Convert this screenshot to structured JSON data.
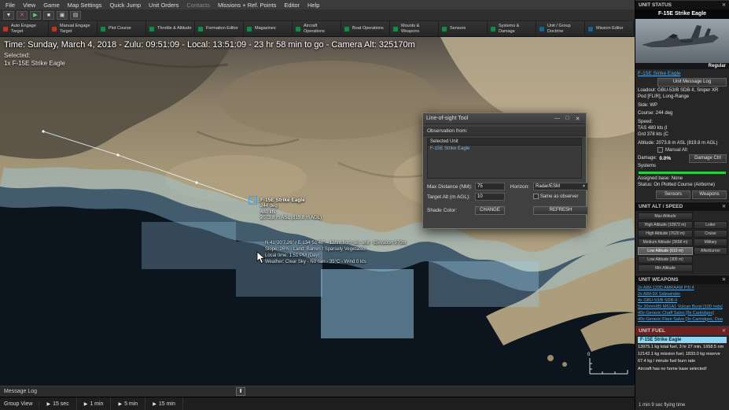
{
  "icons": {
    "close": "✕",
    "dropdown": "▼",
    "play": "▶",
    "stop": "■",
    "camera": "▣",
    "panel": "▤",
    "up_arrow": "⬆",
    "minimize": "—",
    "maximize": "□"
  },
  "colors": {
    "engage_red": "#b03a2e",
    "ops_green": "#1e8449",
    "doctrine_blue": "#21618c",
    "link_blue": "#5aa7e0",
    "systems_ok": "#2ecc40",
    "fuel_warning_header": "#6b2121",
    "selected_fuel_row": "#8fd6f2",
    "los_shade": "#9ed2ee"
  },
  "menu": {
    "items": [
      "File",
      "View",
      "Game",
      "Map Settings",
      "Quick Jump",
      "Unit Orders",
      "Contacts",
      "Missions + Ref. Points",
      "Editor",
      "Help"
    ]
  },
  "ribbon": {
    "buttons": [
      {
        "label": "Auto Engage Target",
        "color": "#b03a2e"
      },
      {
        "label": "Manual Engage Target",
        "color": "#b03a2e"
      },
      {
        "label": "Plot Course",
        "color": "#1e8449"
      },
      {
        "label": "Throttle & Altitude",
        "color": "#1e8449"
      },
      {
        "label": "Formation Editor",
        "color": "#1e8449"
      },
      {
        "label": "Magazines",
        "color": "#1e8449"
      },
      {
        "label": "Aircraft Operations",
        "color": "#1e8449"
      },
      {
        "label": "Boat Operations",
        "color": "#1e8449"
      },
      {
        "label": "Mounts & Weapons",
        "color": "#1e8449"
      },
      {
        "label": "Sensors",
        "color": "#1e8449"
      },
      {
        "label": "Systems & Damage",
        "color": "#1e8449"
      },
      {
        "label": "Unit / Group Doctrine",
        "color": "#21618c"
      },
      {
        "label": "Mission Editor",
        "color": "#21618c"
      }
    ]
  },
  "statusline": "Time: Sunday, March 4, 2018 - Zulu: 09:51:09 - Local: 13:51:09 - 23 hr 58 min to go -  Camera Alt: 325170m",
  "selected": {
    "label": "Selected:",
    "value": "1x F-15E Strike Eagle"
  },
  "map": {
    "unit_label": {
      "line1": "F-15E Strike Eagle",
      "line2": "244 deg",
      "line3": "480 kts",
      "line4": "2073.8 m ASL (819.8 m AGL)"
    },
    "cursor_info": {
      "line1": "N 41°20'7.26\" / E 134°51'40\" - 12nm from sel. unit - Elevation 970m",
      "line2": "Slope: 26% - Land: Barren / Sparsely Vegetated",
      "line3": "Local time: 1:51 PM (Day)",
      "line4": "Weather: Clear Sky - No rain - 35°C - Wind 0 kts"
    },
    "scale_zero": "0"
  },
  "dialog": {
    "title": "Line-of-sight Tool",
    "observation_label": "Observation from:",
    "list_header": "Selected Unit",
    "list_item": "F-15E Strike Eagle",
    "max_distance_label": "Max Distance (NM):",
    "max_distance_value": "75",
    "horizon_label": "Horizon:",
    "horizon_value": "Radar/ESM",
    "target_alt_label": "Target Alt (m AGL):",
    "target_alt_value": "10",
    "same_as_observer": "Same as observer",
    "shade_color_label": "Shade Color:",
    "change_button": "CHANGE",
    "refresh_button": "REFRESH"
  },
  "sidebar": {
    "unit_status": {
      "header": "UNIT STATUS",
      "title": "F-15E Strike Eagle",
      "proficiency": "Regular",
      "unit_link": "F-15E Strike Eagle",
      "message_log_button": "Unit Message Log",
      "loadout": "Loadout: GBU-53/B SDB-II, Sniper XR Pod [FLIR], Long-Range",
      "side": "Side: WP",
      "course": "Course: 244 deg",
      "speed_label": "Speed:",
      "speed_tas": "TAS 480 kts (I",
      "speed_grd": "Grd 378 kts (C",
      "altitude": "Altitude: 2073.8 m ASL (819.8 m AGL)",
      "manual_alt": "Manual Alt",
      "damage_label": "Damage:",
      "damage_value": "0.0%",
      "damage_button": "Damage Ctrl",
      "systems_label": "Systems",
      "assigned_base": "Assigned base: None",
      "status": "Status: On Plotted Course (Airborne)",
      "sensors_button": "Sensors",
      "weapons_button": "Weapons"
    },
    "alt_speed": {
      "header": "UNIT ALT / SPEED",
      "rows": [
        {
          "left": "Max Altitude",
          "right": ""
        },
        {
          "left": "High Altitude (10972 m)",
          "right": "Loiter"
        },
        {
          "left": "High Altitude (7620 m)",
          "right": "Cruise"
        },
        {
          "left": "Medium Altitude (3658 m)",
          "right": "Military"
        },
        {
          "left": "Low Altitude (610 m)",
          "right": "Afterburner"
        },
        {
          "left": "Low Altitude (305 m)",
          "right": ""
        },
        {
          "left": "Min Altitude",
          "right": ""
        }
      ]
    },
    "weapons": {
      "header": "UNIT WEAPONS",
      "items": [
        "2x AIM-120D AMRAAM P3I.4",
        "2x AIM-9X Sidewinder",
        "4x GBU-53/B SDB-II",
        "5x 20mm/85 M61A1 Vulcan Burst [100 rnds]",
        "40x Generic Chaff Salvo [8x Cartridges]",
        "40x Generic Flare Salvo [3x Cartridges, Dua"
      ]
    },
    "fuel": {
      "header": "UNIT FUEL",
      "selected_unit": "F-15E Strike Eagle",
      "lines": [
        "13975.1 kg total fuel, 3 hr 27 min, 1658.5 nm",
        "12142.1 kg mission fuel, 1833.0 kg reserve",
        "67.4 kg / minute fuel burn rate",
        "Aircraft has no home base selected!"
      ]
    },
    "flying_time": "1 min 9 sec flying time"
  },
  "message_log": {
    "label": "Message Log"
  },
  "timebar": {
    "group_view": "Group View",
    "steps": [
      "15 sec",
      "1 min",
      "5 min",
      "15 min"
    ]
  }
}
